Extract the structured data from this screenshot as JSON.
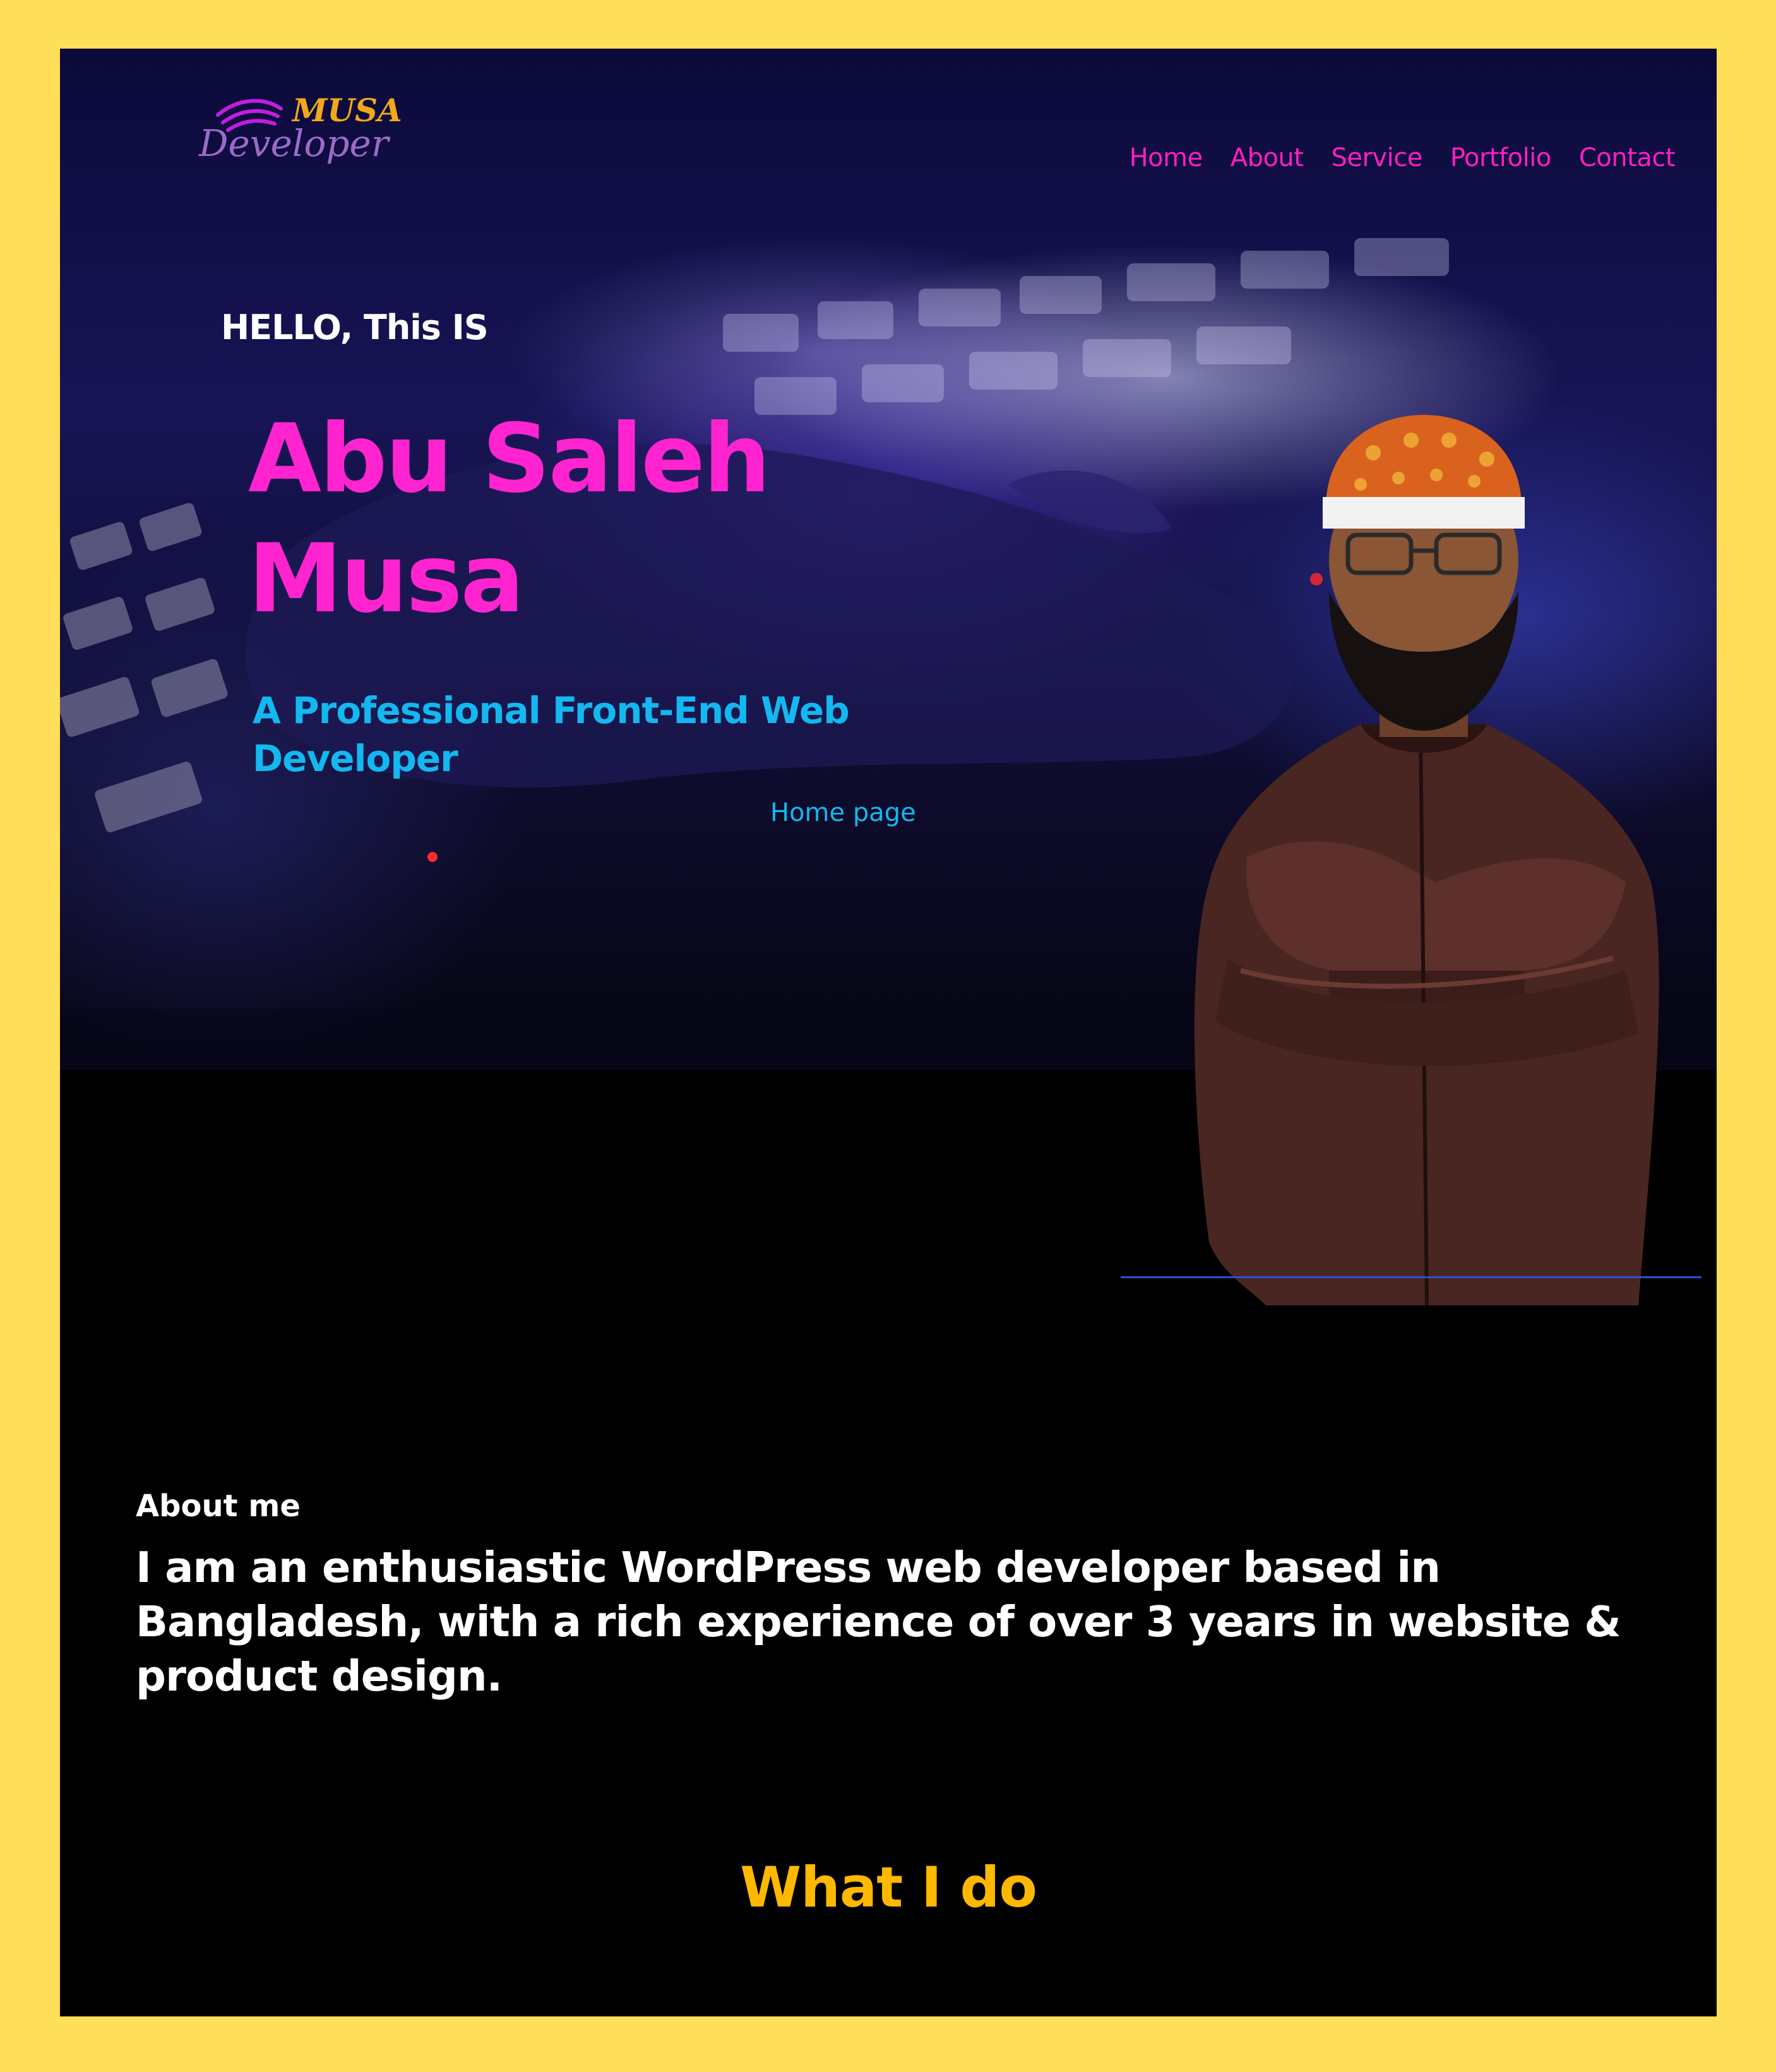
{
  "brand": {
    "logo_word_top": "MUSA",
    "logo_word_bottom": "Developer"
  },
  "nav": {
    "items": [
      "Home",
      "About",
      "Service",
      "Portfolio",
      "Contact"
    ]
  },
  "hero": {
    "greeting": "HELLO, This IS",
    "name": "Abu Saleh Musa",
    "tagline": "A Professional Front-End Web Developer",
    "home_link": "Home page"
  },
  "about": {
    "label": "About me",
    "text": "I am an enthusiastic WordPress web developer based in Bangladesh, with a rich experience of over 3 years in website & product design."
  },
  "services": {
    "heading": "What I do"
  },
  "colors": {
    "page_border": "#ffde59",
    "nav_link": "#ff1fc2",
    "name": "#ff24d0",
    "tagline": "#13b8f0",
    "heading_accent": "#ffb800"
  }
}
